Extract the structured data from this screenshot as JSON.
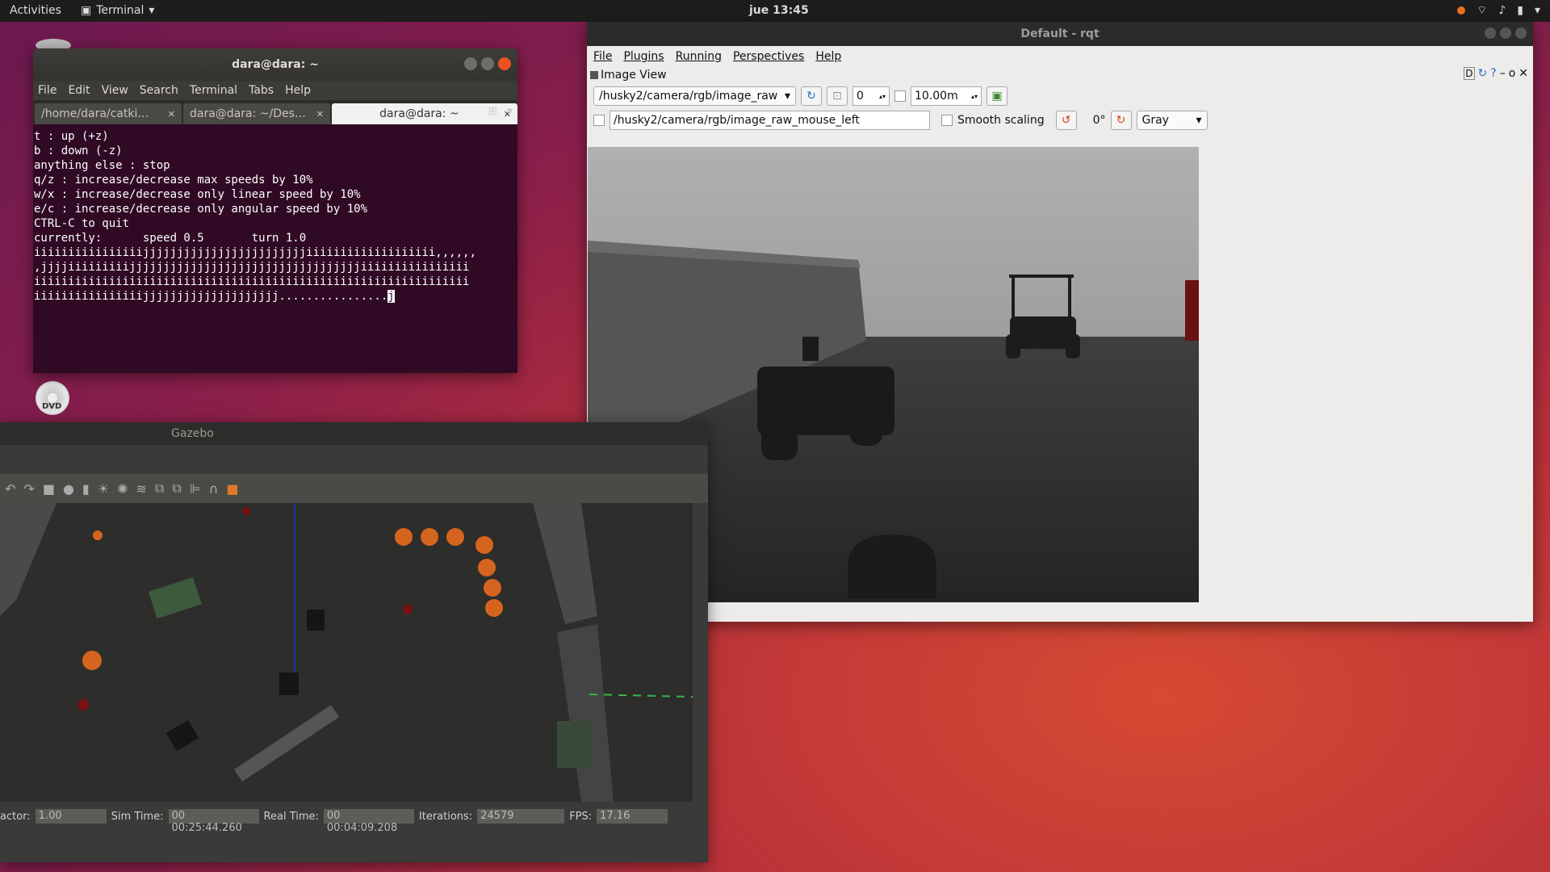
{
  "topbar": {
    "activities": "Activities",
    "app": "Terminal",
    "clock": "jue 13:45"
  },
  "desktop": {
    "dvd_label": "DVD"
  },
  "terminal": {
    "title": "dara@dara: ~",
    "menu": [
      "File",
      "Edit",
      "View",
      "Search",
      "Terminal",
      "Tabs",
      "Help"
    ],
    "tabs": [
      "/home/dara/catki…",
      "dara@dara: ~/Des…",
      "dara@dara: ~"
    ],
    "lines": [
      "t : up (+z)",
      "b : down (-z)",
      "",
      "anything else : stop",
      "",
      "q/z : increase/decrease max speeds by 10%",
      "w/x : increase/decrease only linear speed by 10%",
      "e/c : increase/decrease only angular speed by 10%",
      "",
      "CTRL-C to quit",
      "",
      "currently:      speed 0.5       turn 1.0",
      "iiiiiiiiiiiiiiiijjjjjjjjjjjjjjjjjjjjjjjjiiiiiiiiiiiiiiiiiii,,,,,,",
      ",jjjjiiiiiiiiijjjjjjjjjjjjjjjjjjjjjjjjjjjjjjjjjjiiiiiiiiiiiiiiii",
      "iiiiiiiiiiiiiiiiiiiiiiiiiiiiiiiiiiiiiiiiiiiiiiiiiiiiiiiiiiiiiiii",
      "iiiiiiiiiiiiiiiijjjjjjjjjjjjjjjjjjjj................"
    ],
    "cursor_char": "j"
  },
  "rqt": {
    "title": "Default - rqt",
    "menu": [
      "File",
      "Plugins",
      "Running",
      "Perspectives",
      "Help"
    ],
    "plugin_title": "Image View",
    "plugin_ctrls": "D",
    "topic": "/husky2/camera/rgb/image_raw",
    "spin_value": "0",
    "max_range": "10.00m",
    "mouse_topic": "/husky2/camera/rgb/image_raw_mouse_left",
    "smooth_scaling": "Smooth scaling",
    "rotation": "0°",
    "colormap": "Gray"
  },
  "gazebo": {
    "title": "Gazebo",
    "status": {
      "factor_label": "actor:",
      "factor": "1.00",
      "sim_label": "Sim Time:",
      "sim": "00 00:25:44.260",
      "real_label": "Real Time:",
      "real": "00 00:04:09.208",
      "iter_label": "Iterations:",
      "iter": "24579",
      "fps_label": "FPS:",
      "fps": "17.16"
    }
  }
}
